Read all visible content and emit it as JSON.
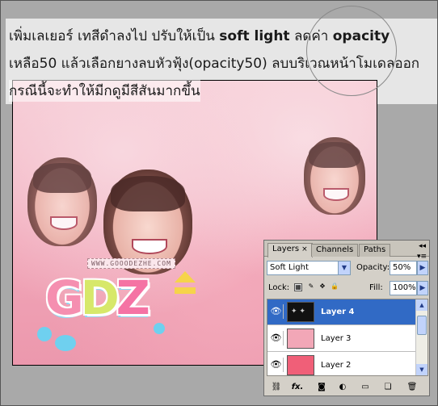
{
  "caption": {
    "line1_a": "เพิ่มเลเยอร์ เทสีดำลงไป ปรับให้เป็น ",
    "line1_b": "soft light",
    "line1_c": " ลดค่า ",
    "line1_d": "opacity",
    "line2": "เหลือ50 แล้วเลือกยางลบหัวฟุ้ง(opacity50) ลบบริเวณหน้าโมเดลออก",
    "line3": "กรณีนี้จะทำให้มีกดูมีสีสันมากขึ้น"
  },
  "artwork": {
    "url_tag": "WWW.GOOODEZHE.COM",
    "logo_g": "G",
    "logo_d": "D",
    "logo_z": "Z"
  },
  "layers_panel": {
    "tabs": [
      "Layers",
      "Channels",
      "Paths"
    ],
    "tab_close": "×",
    "blend_mode": "Soft Light",
    "opacity_label": "Opacity:",
    "opacity_value": "50%",
    "lock_label": "Lock:",
    "fill_label": "Fill:",
    "fill_value": "100%",
    "layers": [
      {
        "name": "Layer 4",
        "selected": true,
        "visible": true
      },
      {
        "name": "Layer 3",
        "selected": false,
        "visible": true
      },
      {
        "name": "Layer 2",
        "selected": false,
        "visible": true
      }
    ],
    "bottom_icons": [
      "link-icon",
      "fx-icon",
      "mask-icon",
      "adjustment-icon",
      "folder-icon",
      "new-layer-icon",
      "trash-icon"
    ]
  },
  "colors": {
    "selection": "#316ac5",
    "panel_bg": "#d4d0c8",
    "canvas_pink": "#f1a6b8"
  }
}
